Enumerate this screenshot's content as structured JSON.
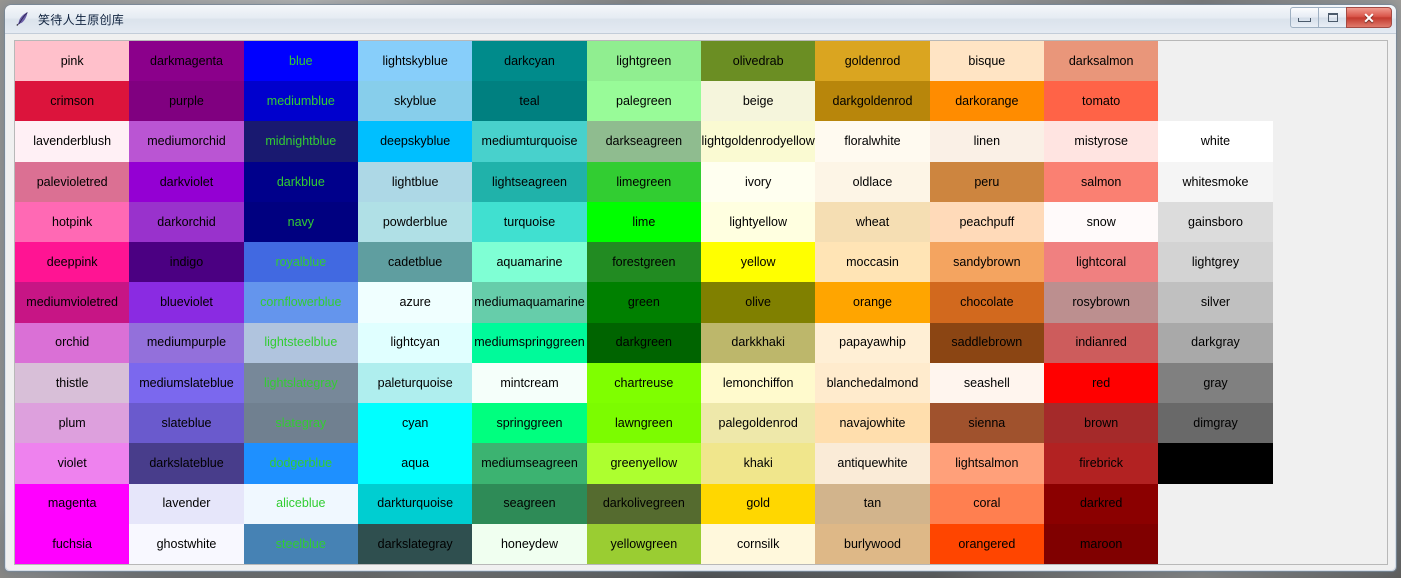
{
  "window": {
    "title": "笑待人生原创库",
    "icon": "quill-pen-icon",
    "background_color": "#F0F0F0",
    "controls": {
      "minimize_label": "",
      "maximize_label": "",
      "close_label": "✕",
      "minimize_name": "minimize-button",
      "maximize_name": "maximize-button",
      "close_name": "close-button"
    }
  },
  "grid": {
    "columns": 12,
    "rows": 13,
    "default_text_color": "#000000",
    "blue_column_text_color": "#32CD32",
    "cells": [
      [
        {
          "label": "pink",
          "color": "#FFC0CB",
          "text": "#000000"
        },
        {
          "label": "darkmagenta",
          "color": "#8B008B",
          "text": "#000000"
        },
        {
          "label": "blue",
          "color": "#0000FF",
          "text": "#32CD32"
        },
        {
          "label": "lightskyblue",
          "color": "#87CEFA",
          "text": "#000000"
        },
        {
          "label": "darkcyan",
          "color": "#008B8B",
          "text": "#000000"
        },
        {
          "label": "lightgreen",
          "color": "#90EE90",
          "text": "#000000"
        },
        {
          "label": "olivedrab",
          "color": "#6B8E23",
          "text": "#000000"
        },
        {
          "label": "goldenrod",
          "color": "#DAA520",
          "text": "#000000"
        },
        {
          "label": "bisque",
          "color": "#FFE4C4",
          "text": "#000000"
        },
        {
          "label": "darksalmon",
          "color": "#E9967A",
          "text": "#000000"
        },
        {
          "label": "",
          "color": "#F0F0F0",
          "text": "#000000"
        },
        {
          "label": "",
          "color": "#F0F0F0",
          "text": "#000000"
        }
      ],
      [
        {
          "label": "crimson",
          "color": "#DC143C",
          "text": "#000000"
        },
        {
          "label": "purple",
          "color": "#800080",
          "text": "#000000"
        },
        {
          "label": "mediumblue",
          "color": "#0000CD",
          "text": "#32CD32"
        },
        {
          "label": "skyblue",
          "color": "#87CEEB",
          "text": "#000000"
        },
        {
          "label": "teal",
          "color": "#008080",
          "text": "#000000"
        },
        {
          "label": "palegreen",
          "color": "#98FB98",
          "text": "#000000"
        },
        {
          "label": "beige",
          "color": "#F5F5DC",
          "text": "#000000"
        },
        {
          "label": "darkgoldenrod",
          "color": "#B8860B",
          "text": "#000000"
        },
        {
          "label": "darkorange",
          "color": "#FF8C00",
          "text": "#000000"
        },
        {
          "label": "tomato",
          "color": "#FF6347",
          "text": "#000000"
        },
        {
          "label": "",
          "color": "#F0F0F0",
          "text": "#000000"
        },
        {
          "label": "",
          "color": "#F0F0F0",
          "text": "#000000"
        }
      ],
      [
        {
          "label": "lavenderblush",
          "color": "#FFF0F5",
          "text": "#000000"
        },
        {
          "label": "mediumorchid",
          "color": "#BA55D3",
          "text": "#000000"
        },
        {
          "label": "midnightblue",
          "color": "#191970",
          "text": "#32CD32"
        },
        {
          "label": "deepskyblue",
          "color": "#00BFFF",
          "text": "#000000"
        },
        {
          "label": "mediumturquoise",
          "color": "#48D1CC",
          "text": "#000000"
        },
        {
          "label": "darkseagreen",
          "color": "#8FBC8F",
          "text": "#000000"
        },
        {
          "label": "lightgoldenrodyellow",
          "color": "#FAFAD2",
          "text": "#000000"
        },
        {
          "label": "floralwhite",
          "color": "#FFFAF0",
          "text": "#000000"
        },
        {
          "label": "linen",
          "color": "#FAF0E6",
          "text": "#000000"
        },
        {
          "label": "mistyrose",
          "color": "#FFE4E1",
          "text": "#000000"
        },
        {
          "label": "white",
          "color": "#FFFFFF",
          "text": "#000000"
        },
        {
          "label": "",
          "color": "#F0F0F0",
          "text": "#000000"
        }
      ],
      [
        {
          "label": "palevioletred",
          "color": "#DB7093",
          "text": "#000000"
        },
        {
          "label": "darkviolet",
          "color": "#9400D3",
          "text": "#000000"
        },
        {
          "label": "darkblue",
          "color": "#00008B",
          "text": "#32CD32"
        },
        {
          "label": "lightblue",
          "color": "#ADD8E6",
          "text": "#000000"
        },
        {
          "label": "lightseagreen",
          "color": "#20B2AA",
          "text": "#000000"
        },
        {
          "label": "limegreen",
          "color": "#32CD32",
          "text": "#000000"
        },
        {
          "label": "ivory",
          "color": "#FFFFF0",
          "text": "#000000"
        },
        {
          "label": "oldlace",
          "color": "#FDF5E6",
          "text": "#000000"
        },
        {
          "label": "peru",
          "color": "#CD853F",
          "text": "#000000"
        },
        {
          "label": "salmon",
          "color": "#FA8072",
          "text": "#000000"
        },
        {
          "label": "whitesmoke",
          "color": "#F5F5F5",
          "text": "#000000"
        },
        {
          "label": "",
          "color": "#F0F0F0",
          "text": "#000000"
        }
      ],
      [
        {
          "label": "hotpink",
          "color": "#FF69B4",
          "text": "#000000"
        },
        {
          "label": "darkorchid",
          "color": "#9932CC",
          "text": "#000000"
        },
        {
          "label": "navy",
          "color": "#000080",
          "text": "#32CD32"
        },
        {
          "label": "powderblue",
          "color": "#B0E0E6",
          "text": "#000000"
        },
        {
          "label": "turquoise",
          "color": "#40E0D0",
          "text": "#000000"
        },
        {
          "label": "lime",
          "color": "#00FF00",
          "text": "#000000"
        },
        {
          "label": "lightyellow",
          "color": "#FFFFE0",
          "text": "#000000"
        },
        {
          "label": "wheat",
          "color": "#F5DEB3",
          "text": "#000000"
        },
        {
          "label": "peachpuff",
          "color": "#FFDAB9",
          "text": "#000000"
        },
        {
          "label": "snow",
          "color": "#FFFAFA",
          "text": "#000000"
        },
        {
          "label": "gainsboro",
          "color": "#DCDCDC",
          "text": "#000000"
        },
        {
          "label": "",
          "color": "#F0F0F0",
          "text": "#000000"
        }
      ],
      [
        {
          "label": "deeppink",
          "color": "#FF1493",
          "text": "#000000"
        },
        {
          "label": "indigo",
          "color": "#4B0082",
          "text": "#000000"
        },
        {
          "label": "royalblue",
          "color": "#4169E1",
          "text": "#32CD32"
        },
        {
          "label": "cadetblue",
          "color": "#5F9EA0",
          "text": "#000000"
        },
        {
          "label": "aquamarine",
          "color": "#7FFFD4",
          "text": "#000000"
        },
        {
          "label": "forestgreen",
          "color": "#228B22",
          "text": "#000000"
        },
        {
          "label": "yellow",
          "color": "#FFFF00",
          "text": "#000000"
        },
        {
          "label": "moccasin",
          "color": "#FFE4B5",
          "text": "#000000"
        },
        {
          "label": "sandybrown",
          "color": "#F4A460",
          "text": "#000000"
        },
        {
          "label": "lightcoral",
          "color": "#F08080",
          "text": "#000000"
        },
        {
          "label": "lightgrey",
          "color": "#D3D3D3",
          "text": "#000000"
        },
        {
          "label": "",
          "color": "#F0F0F0",
          "text": "#000000"
        }
      ],
      [
        {
          "label": "mediumvioletred",
          "color": "#C71585",
          "text": "#000000"
        },
        {
          "label": "blueviolet",
          "color": "#8A2BE2",
          "text": "#000000"
        },
        {
          "label": "cornflowerblue",
          "color": "#6495ED",
          "text": "#32CD32"
        },
        {
          "label": "azure",
          "color": "#F0FFFF",
          "text": "#000000"
        },
        {
          "label": "mediumaquamarine",
          "color": "#66CDAA",
          "text": "#000000"
        },
        {
          "label": "green",
          "color": "#008000",
          "text": "#000000"
        },
        {
          "label": "olive",
          "color": "#808000",
          "text": "#000000"
        },
        {
          "label": "orange",
          "color": "#FFA500",
          "text": "#000000"
        },
        {
          "label": "chocolate",
          "color": "#D2691E",
          "text": "#000000"
        },
        {
          "label": "rosybrown",
          "color": "#BC8F8F",
          "text": "#000000"
        },
        {
          "label": "silver",
          "color": "#C0C0C0",
          "text": "#000000"
        },
        {
          "label": "",
          "color": "#F0F0F0",
          "text": "#000000"
        }
      ],
      [
        {
          "label": "orchid",
          "color": "#DA70D6",
          "text": "#000000"
        },
        {
          "label": "mediumpurple",
          "color": "#9370DB",
          "text": "#000000"
        },
        {
          "label": "lightsteelblue",
          "color": "#B0C4DE",
          "text": "#32CD32"
        },
        {
          "label": "lightcyan",
          "color": "#E0FFFF",
          "text": "#000000"
        },
        {
          "label": "mediumspringgreen",
          "color": "#00FA9A",
          "text": "#000000"
        },
        {
          "label": "darkgreen",
          "color": "#006400",
          "text": "#000000"
        },
        {
          "label": "darkkhaki",
          "color": "#BDB76B",
          "text": "#000000"
        },
        {
          "label": "papayawhip",
          "color": "#FFEFD5",
          "text": "#000000"
        },
        {
          "label": "saddlebrown",
          "color": "#8B4513",
          "text": "#000000"
        },
        {
          "label": "indianred",
          "color": "#CD5C5C",
          "text": "#000000"
        },
        {
          "label": "darkgray",
          "color": "#A9A9A9",
          "text": "#000000"
        },
        {
          "label": "",
          "color": "#F0F0F0",
          "text": "#000000"
        }
      ],
      [
        {
          "label": "thistle",
          "color": "#D8BFD8",
          "text": "#000000"
        },
        {
          "label": "mediumslateblue",
          "color": "#7B68EE",
          "text": "#000000"
        },
        {
          "label": "lightslategray",
          "color": "#778899",
          "text": "#32CD32"
        },
        {
          "label": "paleturquoise",
          "color": "#AFEEEE",
          "text": "#000000"
        },
        {
          "label": "mintcream",
          "color": "#F5FFFA",
          "text": "#000000"
        },
        {
          "label": "chartreuse",
          "color": "#7FFF00",
          "text": "#000000"
        },
        {
          "label": "lemonchiffon",
          "color": "#FFFACD",
          "text": "#000000"
        },
        {
          "label": "blanchedalmond",
          "color": "#FFEBCD",
          "text": "#000000"
        },
        {
          "label": "seashell",
          "color": "#FFF5EE",
          "text": "#000000"
        },
        {
          "label": "red",
          "color": "#FF0000",
          "text": "#000000"
        },
        {
          "label": "gray",
          "color": "#808080",
          "text": "#000000"
        },
        {
          "label": "",
          "color": "#F0F0F0",
          "text": "#000000"
        }
      ],
      [
        {
          "label": "plum",
          "color": "#DDA0DD",
          "text": "#000000"
        },
        {
          "label": "slateblue",
          "color": "#6A5ACD",
          "text": "#000000"
        },
        {
          "label": "slategray",
          "color": "#708090",
          "text": "#32CD32"
        },
        {
          "label": "cyan",
          "color": "#00FFFF",
          "text": "#000000"
        },
        {
          "label": "springgreen",
          "color": "#00FF7F",
          "text": "#000000"
        },
        {
          "label": "lawngreen",
          "color": "#7CFC00",
          "text": "#000000"
        },
        {
          "label": "palegoldenrod",
          "color": "#EEE8AA",
          "text": "#000000"
        },
        {
          "label": "navajowhite",
          "color": "#FFDEAD",
          "text": "#000000"
        },
        {
          "label": "sienna",
          "color": "#A0522D",
          "text": "#000000"
        },
        {
          "label": "brown",
          "color": "#A52A2A",
          "text": "#000000"
        },
        {
          "label": "dimgray",
          "color": "#696969",
          "text": "#000000"
        },
        {
          "label": "",
          "color": "#F0F0F0",
          "text": "#000000"
        }
      ],
      [
        {
          "label": "violet",
          "color": "#EE82EE",
          "text": "#000000"
        },
        {
          "label": "darkslateblue",
          "color": "#483D8B",
          "text": "#000000"
        },
        {
          "label": "dodgerblue",
          "color": "#1E90FF",
          "text": "#32CD32"
        },
        {
          "label": "aqua",
          "color": "#00FFFF",
          "text": "#000000"
        },
        {
          "label": "mediumseagreen",
          "color": "#3CB371",
          "text": "#000000"
        },
        {
          "label": "greenyellow",
          "color": "#ADFF2F",
          "text": "#000000"
        },
        {
          "label": "khaki",
          "color": "#F0E68C",
          "text": "#000000"
        },
        {
          "label": "antiquewhite",
          "color": "#FAEBD7",
          "text": "#000000"
        },
        {
          "label": "lightsalmon",
          "color": "#FFA07A",
          "text": "#000000"
        },
        {
          "label": "firebrick",
          "color": "#B22222",
          "text": "#000000"
        },
        {
          "label": "",
          "color": "#000000",
          "text": "#000000"
        },
        {
          "label": "",
          "color": "#F0F0F0",
          "text": "#000000"
        }
      ],
      [
        {
          "label": "magenta",
          "color": "#FF00FF",
          "text": "#000000"
        },
        {
          "label": "lavender",
          "color": "#E6E6FA",
          "text": "#000000"
        },
        {
          "label": "aliceblue",
          "color": "#F0F8FF",
          "text": "#32CD32"
        },
        {
          "label": "darkturquoise",
          "color": "#00CED1",
          "text": "#000000"
        },
        {
          "label": "seagreen",
          "color": "#2E8B57",
          "text": "#000000"
        },
        {
          "label": "darkolivegreen",
          "color": "#556B2F",
          "text": "#000000"
        },
        {
          "label": "gold",
          "color": "#FFD700",
          "text": "#000000"
        },
        {
          "label": "tan",
          "color": "#D2B48C",
          "text": "#000000"
        },
        {
          "label": "coral",
          "color": "#FF7F50",
          "text": "#000000"
        },
        {
          "label": "darkred",
          "color": "#8B0000",
          "text": "#000000"
        },
        {
          "label": "",
          "color": "#F0F0F0",
          "text": "#000000"
        },
        {
          "label": "",
          "color": "#F0F0F0",
          "text": "#000000"
        }
      ],
      [
        {
          "label": "fuchsia",
          "color": "#FF00FF",
          "text": "#000000"
        },
        {
          "label": "ghostwhite",
          "color": "#F8F8FF",
          "text": "#000000"
        },
        {
          "label": "steelblue",
          "color": "#4682B4",
          "text": "#32CD32"
        },
        {
          "label": "darkslategray",
          "color": "#2F4F4F",
          "text": "#000000"
        },
        {
          "label": "honeydew",
          "color": "#F0FFF0",
          "text": "#000000"
        },
        {
          "label": "yellowgreen",
          "color": "#9ACD32",
          "text": "#000000"
        },
        {
          "label": "cornsilk",
          "color": "#FFF8DC",
          "text": "#000000"
        },
        {
          "label": "burlywood",
          "color": "#DEB887",
          "text": "#000000"
        },
        {
          "label": "orangered",
          "color": "#FF4500",
          "text": "#000000"
        },
        {
          "label": "maroon",
          "color": "#800000",
          "text": "#000000"
        },
        {
          "label": "",
          "color": "#F0F0F0",
          "text": "#000000"
        },
        {
          "label": "",
          "color": "#F0F0F0",
          "text": "#000000"
        }
      ]
    ]
  }
}
